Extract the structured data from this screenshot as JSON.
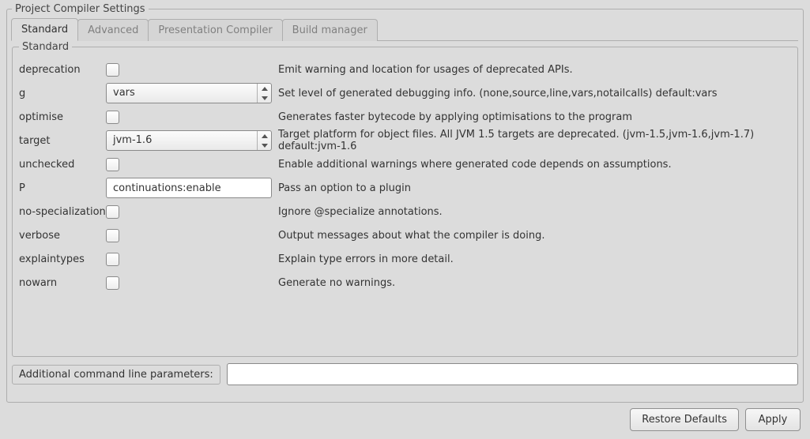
{
  "panel_title": "Project Compiler Settings",
  "tabs": [
    {
      "label": "Standard",
      "active": true
    },
    {
      "label": "Advanced",
      "active": false
    },
    {
      "label": "Presentation Compiler",
      "active": false
    },
    {
      "label": "Build manager",
      "active": false
    }
  ],
  "group_title": "Standard",
  "settings": {
    "deprecation": {
      "label": "deprecation",
      "desc": "Emit warning and location for usages of deprecated APIs."
    },
    "g": {
      "label": "g",
      "value": "vars",
      "desc": "Set level of generated debugging info. (none,source,line,vars,notailcalls) default:vars"
    },
    "optimise": {
      "label": "optimise",
      "desc": "Generates faster bytecode by applying optimisations to the program"
    },
    "target": {
      "label": "target",
      "value": "jvm-1.6",
      "desc": "Target platform for object files. All JVM 1.5 targets are deprecated. (jvm-1.5,jvm-1.6,jvm-1.7) default:jvm-1.6"
    },
    "unchecked": {
      "label": "unchecked",
      "desc": "Enable additional warnings where generated code depends on assumptions."
    },
    "P": {
      "label": "P",
      "value": "continuations:enable",
      "desc": "Pass an option to a plugin"
    },
    "no_specialization": {
      "label": "no-specialization",
      "desc": "Ignore @specialize annotations."
    },
    "verbose": {
      "label": "verbose",
      "desc": "Output messages about what the compiler is doing."
    },
    "explaintypes": {
      "label": "explaintypes",
      "desc": "Explain type errors in more detail."
    },
    "nowarn": {
      "label": "nowarn",
      "desc": "Generate no warnings."
    }
  },
  "additional": {
    "label": "Additional command line parameters:",
    "value": ""
  },
  "buttons": {
    "restore": "Restore Defaults",
    "apply": "Apply"
  }
}
